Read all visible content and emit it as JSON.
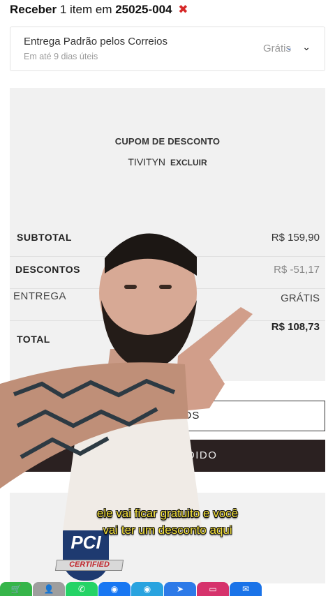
{
  "header": {
    "prefix": "Receber",
    "count_text": "1 item em",
    "zip": "25025-004",
    "close_glyph": "✖"
  },
  "shipping": {
    "name": "Entrega Padrão pelos Correios",
    "eta": "Em até 9 dias úteis",
    "price": "Grátis",
    "blue_chevron": "⌄",
    "chevron": "⌄"
  },
  "coupon": {
    "title": "CUPOM DE DESCONTO",
    "code": "TIVITYN",
    "remove_label": "EXCLUIR"
  },
  "totals": {
    "subtotal_label": "SUBTOTAL",
    "subtotal_value": "R$ 159,90",
    "discount_label": "DESCONTOS",
    "discount_value": "R$ -51,17",
    "delivery_label": "ENTREGA",
    "delivery_value": "GRÁTIS",
    "total_label": "TOTAL",
    "total_value": "R$ 108,73"
  },
  "buttons": {
    "products_label": "PRODUTOS",
    "checkout_label": "FECHAR PEDIDO"
  },
  "badge": {
    "letters": "PCI",
    "ribbon": "CERTIFIED"
  },
  "captions": {
    "line1": "ele vai ficar gratuito e você",
    "line2": "vai ter um desconto aqui"
  },
  "bottom_bar": {
    "colors": [
      "#36b54a",
      "#9e9e9e",
      "#25d366",
      "#1877f2",
      "#29a3df",
      "#2d7ae8",
      "#d6336c",
      "#1a73e8"
    ]
  }
}
